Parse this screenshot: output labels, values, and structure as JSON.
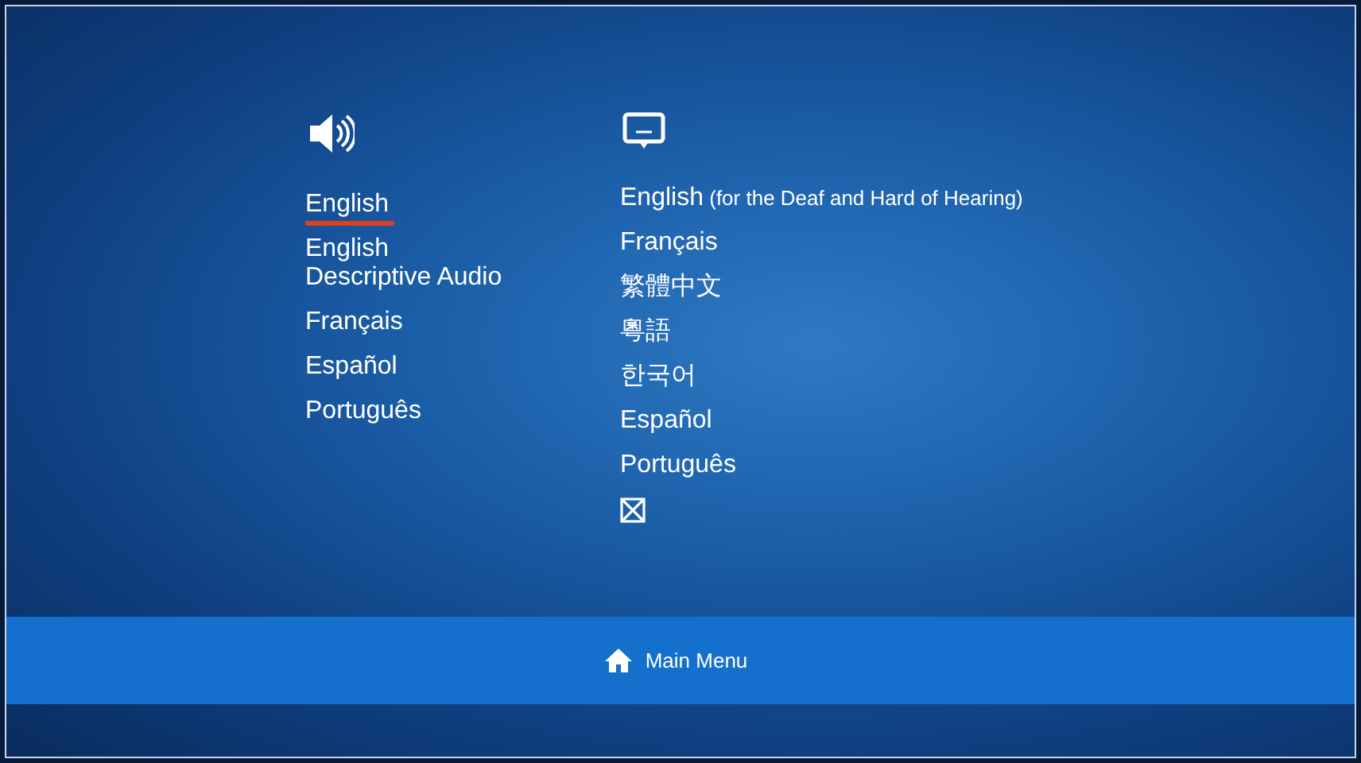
{
  "audio": {
    "items": [
      {
        "lines": [
          "English"
        ],
        "selected": true
      },
      {
        "lines": [
          "English",
          "Descriptive Audio"
        ],
        "selected": false
      },
      {
        "lines": [
          "Français"
        ],
        "selected": false
      },
      {
        "lines": [
          "Español"
        ],
        "selected": false
      },
      {
        "lines": [
          "Português"
        ],
        "selected": false
      }
    ]
  },
  "subtitles": {
    "items": [
      {
        "kind": "text",
        "label": "English",
        "note": "(for the Deaf and Hard of Hearing)",
        "selected": false
      },
      {
        "kind": "text",
        "label": "Français",
        "selected": false
      },
      {
        "kind": "text",
        "label": "繁體中文",
        "selected": false
      },
      {
        "kind": "text",
        "label": "粵語",
        "selected": false
      },
      {
        "kind": "text",
        "label": "한국어",
        "selected": false
      },
      {
        "kind": "text",
        "label": "Español",
        "selected": false
      },
      {
        "kind": "text",
        "label": "Português",
        "selected": false
      },
      {
        "kind": "off",
        "selected": false
      }
    ]
  },
  "footer": {
    "main_menu": "Main Menu"
  }
}
